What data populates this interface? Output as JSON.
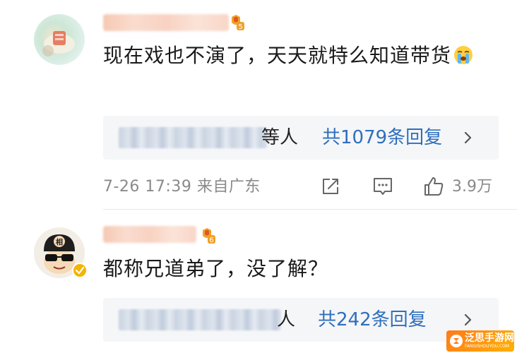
{
  "comments": [
    {
      "username": "",
      "level_badge": "5",
      "text": "现在戏也不演了，天天就特么知道带货",
      "emoji": "crying-face",
      "reply_suffix": "等人",
      "reply_count": "共1079条回复",
      "timestamp": "7-26  17:39  来自广东",
      "like_count": "3.9万",
      "icons": {
        "share": "share-icon",
        "comment": "comment-icon",
        "like": "thumbs-up-icon",
        "chevron": "chevron-right-icon"
      }
    },
    {
      "username": "",
      "level_badge": "6",
      "avatar_character": "相",
      "verified": true,
      "text": "都称兄道弟了，没了解？",
      "reply_suffix": "人",
      "reply_count": "共242条回复",
      "icons": {
        "chevron": "chevron-right-icon"
      }
    }
  ],
  "watermark": {
    "title": "泛思手游网",
    "subtitle": "FANSISHOUYOU.COM"
  },
  "colors": {
    "link": "#2f6fbd",
    "meta": "#8a8a8a",
    "reply_bg": "#f5f6f8"
  }
}
